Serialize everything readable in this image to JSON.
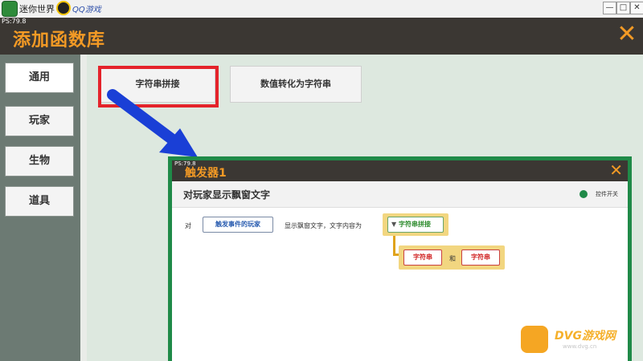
{
  "os_bar": {
    "app_title": "迷你世界",
    "qq_label": "QQ游戏",
    "minimize": "—",
    "maximize": "□",
    "close": "✕"
  },
  "version_label": "PS:79.8",
  "header": {
    "title": "添加函数库",
    "close_icon": "✕"
  },
  "sidebar": {
    "items": [
      {
        "label": "通用",
        "active": true
      },
      {
        "label": "玩家",
        "active": false
      },
      {
        "label": "生物",
        "active": false
      },
      {
        "label": "道具",
        "active": false
      }
    ]
  },
  "functions": [
    {
      "label": "字符串拼接",
      "highlighted": true
    },
    {
      "label": "数值转化为字符串",
      "highlighted": false
    }
  ],
  "dialog": {
    "version": "PS:79.8",
    "title": "触发器1",
    "close_icon": "✕",
    "subtitle": "对玩家显示飘窗文字",
    "toggle_label": "控件开关",
    "row": {
      "prefix": "对",
      "target_chip": "触发事件的玩家",
      "middle": "显示飘窗文字，文字内容为",
      "dropdown_arrow": "▼",
      "function_chip": "字符串拼接",
      "arg1": "字符串",
      "conjunction": "和",
      "arg2": "字符串"
    }
  },
  "watermark": {
    "text": "DVG游戏网",
    "url": "www.dvg.cn"
  },
  "colors": {
    "accent_orange": "#f39a25",
    "header_dark": "#3b3733",
    "dialog_border_green": "#1f8a48",
    "highlight_red": "#e4232a",
    "arrow_blue": "#1a3fd6"
  }
}
